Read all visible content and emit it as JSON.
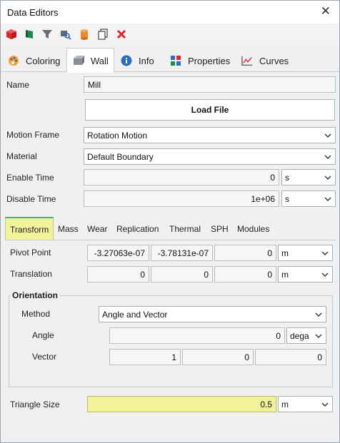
{
  "window": {
    "title": "Data Editors",
    "close_glyph": "✕"
  },
  "toolbar": {
    "icons": [
      "red-cube-icon",
      "green-flag-icon",
      "funnel-icon",
      "search-doc-icon",
      "orange-cylinder-icon",
      "copy-icon",
      "delete-icon"
    ]
  },
  "main_tabs": [
    {
      "label": "Coloring",
      "icon": "palette-icon"
    },
    {
      "label": "Wall",
      "icon": "wall-icon",
      "active": true
    },
    {
      "label": "Info",
      "icon": "info-icon"
    },
    {
      "label": "Properties",
      "icon": "properties-icon"
    },
    {
      "label": "Curves",
      "icon": "curves-icon"
    }
  ],
  "wall": {
    "name_label": "Name",
    "name_value": "Mill",
    "load_file_label": "Load File",
    "motion_frame_label": "Motion Frame",
    "motion_frame_value": "Rotation Motion",
    "material_label": "Material",
    "material_value": "Default Boundary",
    "enable_time_label": "Enable Time",
    "enable_time_value": "0",
    "enable_time_unit": "s",
    "disable_time_label": "Disable Time",
    "disable_time_value": "1e+06",
    "disable_time_unit": "s"
  },
  "sub_tabs": [
    {
      "label": "Transform",
      "active": true
    },
    {
      "label": "Mass"
    },
    {
      "label": "Wear"
    },
    {
      "label": "Replication"
    },
    {
      "label": "Thermal"
    },
    {
      "label": "SPH"
    },
    {
      "label": "Modules"
    }
  ],
  "transform": {
    "pivot_label": "Pivot Point",
    "pivot": [
      "-3.27063e-07",
      "-3.78131e-07",
      "0"
    ],
    "pivot_unit": "m",
    "translation_label": "Translation",
    "translation": [
      "0",
      "0",
      "0"
    ],
    "translation_unit": "m",
    "orientation_title": "Orientation",
    "method_label": "Method",
    "method_value": "Angle and Vector",
    "angle_label": "Angle",
    "angle_value": "0",
    "angle_unit": "dega",
    "vector_label": "Vector",
    "vector": [
      "1",
      "0",
      "0"
    ],
    "triangle_label": "Triangle Size",
    "triangle_value": "0.5",
    "triangle_unit": "m"
  },
  "colors": {
    "active_tab_yellow": "#f2f29b",
    "active_tab_green": "#3fb27f",
    "delete_red": "#e0262b"
  }
}
